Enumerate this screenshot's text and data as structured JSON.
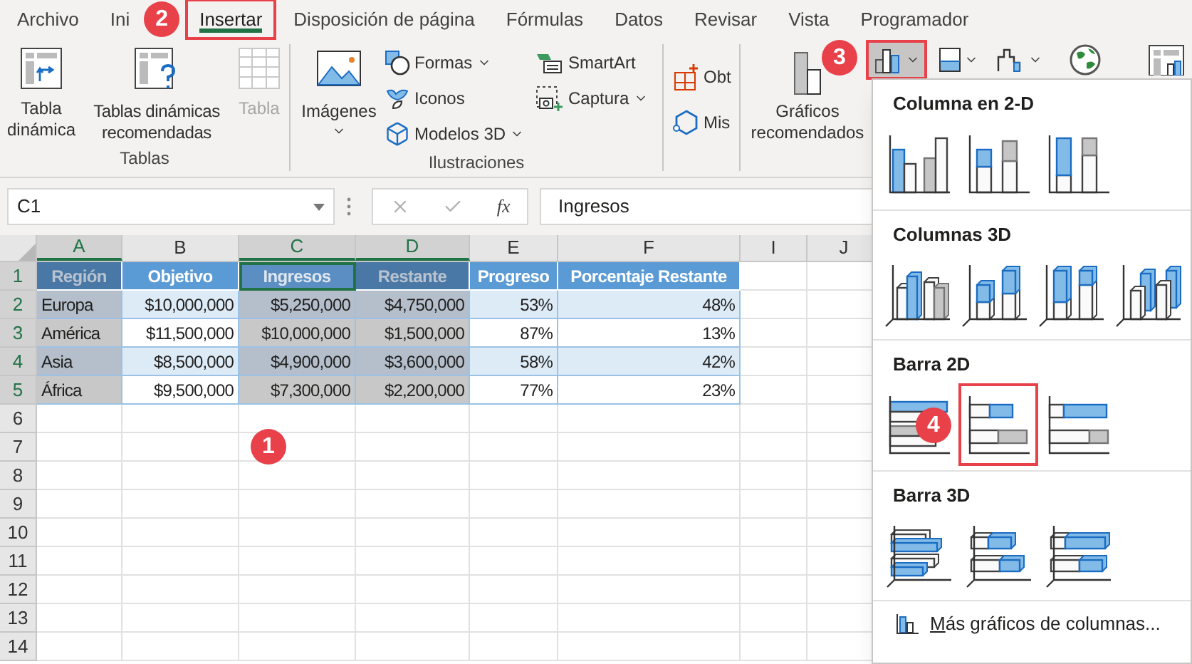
{
  "menu_tabs": [
    {
      "label": "Archivo",
      "selected": false,
      "highlighted": false
    },
    {
      "label": "Ini",
      "selected": false,
      "highlighted": false
    },
    {
      "label": "Insertar",
      "selected": true,
      "highlighted": true
    },
    {
      "label": "Disposición de página",
      "selected": false,
      "highlighted": false
    },
    {
      "label": "Fórmulas",
      "selected": false,
      "highlighted": false
    },
    {
      "label": "Datos",
      "selected": false,
      "highlighted": false
    },
    {
      "label": "Revisar",
      "selected": false,
      "highlighted": false
    },
    {
      "label": "Vista",
      "selected": false,
      "highlighted": false
    },
    {
      "label": "Programador",
      "selected": false,
      "highlighted": false
    }
  ],
  "ribbon": {
    "tables_group": {
      "label": "Tablas",
      "buttons": [
        {
          "kind": "pivot",
          "label": "Tabla dinámica",
          "disabled": false
        },
        {
          "kind": "recommended-pivot",
          "label": "Tablas dinámicas recomendadas",
          "disabled": false
        },
        {
          "kind": "table",
          "label": "Tabla",
          "disabled": true
        }
      ]
    },
    "illustrations_group": {
      "label": "Ilustraciones",
      "images_button": {
        "label": "Imágenes",
        "has_menu": true
      },
      "small_buttons": [
        {
          "kind": "shapes",
          "label": "Formas",
          "has_menu": true
        },
        {
          "kind": "icons",
          "label": "Iconos",
          "has_menu": false
        },
        {
          "kind": "models",
          "label": "Modelos 3D",
          "has_menu": true
        },
        {
          "kind": "smartart",
          "label": "SmartArt",
          "has_menu": false
        },
        {
          "kind": "screenshot",
          "label": "Captura",
          "has_menu": true
        }
      ]
    },
    "addins_buttons": [
      {
        "kind": "get",
        "label": "Obt"
      },
      {
        "kind": "mine",
        "label": "Mis"
      }
    ],
    "recommended_charts": {
      "label": "Gráficos recomendados"
    },
    "chart_buttons": [
      {
        "kind": "column",
        "has_menu": true,
        "highlighted": true
      },
      {
        "kind": "hierarchy",
        "has_menu": true,
        "highlighted": false
      },
      {
        "kind": "waterfall",
        "has_menu": true,
        "highlighted": false
      },
      {
        "kind": "globe",
        "has_menu": false,
        "highlighted": false
      },
      {
        "kind": "pivot-chart",
        "has_menu": false,
        "highlighted": false
      }
    ]
  },
  "formula_bar": {
    "name_box": "C1",
    "function_label": "fx",
    "value": "Ingresos"
  },
  "sheet": {
    "columns": [
      {
        "label": "A",
        "selected": true
      },
      {
        "label": "B",
        "selected": false
      },
      {
        "label": "C",
        "selected": true
      },
      {
        "label": "D",
        "selected": true
      },
      {
        "label": "E",
        "selected": false
      },
      {
        "label": "F",
        "selected": false
      },
      {
        "label": "I",
        "selected": false
      },
      {
        "label": "J",
        "selected": false
      }
    ],
    "rows": [
      {
        "number": "1",
        "selected": true,
        "kind": "header",
        "cells": [
          {
            "text": "Región",
            "active": false
          },
          {
            "text": "Objetivo",
            "active": false
          },
          {
            "text": "Ingresos",
            "active": true
          },
          {
            "text": "Restante",
            "active": false
          },
          {
            "text": "Progreso",
            "active": false
          },
          {
            "text": "Porcentaje Restante",
            "active": false
          }
        ]
      },
      {
        "number": "2",
        "selected": true,
        "kind": "data",
        "cells": [
          "Europa",
          "$10,000,000",
          "$5,250,000",
          "$4,750,000",
          "53%",
          "48%"
        ]
      },
      {
        "number": "3",
        "selected": true,
        "kind": "data",
        "cells": [
          "América",
          "$11,500,000",
          "$10,000,000",
          "$1,500,000",
          "87%",
          "13%"
        ]
      },
      {
        "number": "4",
        "selected": true,
        "kind": "data",
        "cells": [
          "Asia",
          "$8,500,000",
          "$4,900,000",
          "$3,600,000",
          "58%",
          "42%"
        ]
      },
      {
        "number": "5",
        "selected": true,
        "kind": "data",
        "cells": [
          "África",
          "$9,500,000",
          "$7,300,000",
          "$2,200,000",
          "77%",
          "23%"
        ]
      },
      {
        "number": "6",
        "selected": false,
        "kind": "empty"
      },
      {
        "number": "7",
        "selected": false,
        "kind": "empty"
      },
      {
        "number": "8",
        "selected": false,
        "kind": "empty"
      },
      {
        "number": "9",
        "selected": false,
        "kind": "empty"
      },
      {
        "number": "10",
        "selected": false,
        "kind": "empty"
      },
      {
        "number": "11",
        "selected": false,
        "kind": "empty"
      },
      {
        "number": "12",
        "selected": false,
        "kind": "empty"
      },
      {
        "number": "13",
        "selected": false,
        "kind": "empty"
      },
      {
        "number": "14",
        "selected": false,
        "kind": "empty"
      }
    ]
  },
  "chart_menu": {
    "sections": [
      {
        "title": "Columna en 2-D",
        "charts": [
          {
            "kind": "col-clustered",
            "highlighted": false
          },
          {
            "kind": "col-stacked",
            "highlighted": false
          },
          {
            "kind": "col-percent",
            "highlighted": false
          }
        ]
      },
      {
        "title": "Columnas 3D",
        "charts": [
          {
            "kind": "col3d-clustered",
            "highlighted": false
          },
          {
            "kind": "col3d-stacked",
            "highlighted": false
          },
          {
            "kind": "col3d-percent",
            "highlighted": false
          },
          {
            "kind": "col3d",
            "highlighted": false
          }
        ]
      },
      {
        "title": "Barra 2D",
        "charts": [
          {
            "kind": "bar-clustered",
            "highlighted": false
          },
          {
            "kind": "bar-stacked",
            "highlighted": true
          },
          {
            "kind": "bar-percent",
            "highlighted": false
          }
        ]
      },
      {
        "title": "Barra 3D",
        "charts": [
          {
            "kind": "bar3d-clustered",
            "highlighted": false
          },
          {
            "kind": "bar3d-stacked",
            "highlighted": false
          },
          {
            "kind": "bar3d-percent",
            "highlighted": false
          }
        ]
      }
    ],
    "more_link": "Más gráficos de columnas..."
  },
  "annotations": [
    {
      "label": "2"
    },
    {
      "label": "3"
    },
    {
      "label": "4"
    },
    {
      "label": "1"
    }
  ]
}
